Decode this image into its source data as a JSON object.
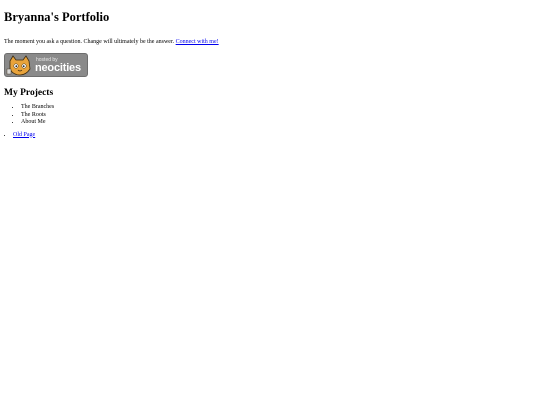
{
  "header": {
    "title": "Bryanna's Portfolio"
  },
  "intro": {
    "text": "The moment you ask a question. Change will ultimately be the answer.",
    "link_label": "Connect with me!"
  },
  "badge": {
    "hosted_text": "hosted by",
    "brand_text": "neocities"
  },
  "projects": {
    "heading": "My Projects",
    "items": [
      "The Branches",
      "The Roots",
      "About Me"
    ]
  },
  "links": {
    "old_page_label": "Old Page"
  },
  "colors": {
    "link": "#0000ee",
    "badge_bg": "#8a8a8a",
    "cat_orange": "#e8a33b"
  }
}
